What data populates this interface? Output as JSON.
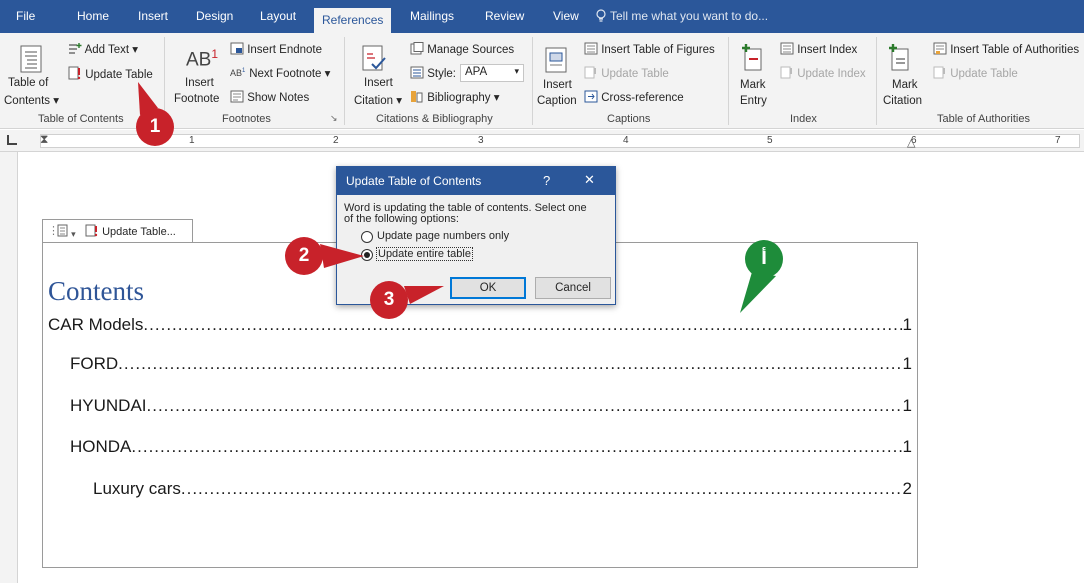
{
  "tabs": [
    "File",
    "Home",
    "Insert",
    "Design",
    "Layout",
    "References",
    "Mailings",
    "Review",
    "View"
  ],
  "tell_me": "Tell me what you want to do...",
  "ribbon": {
    "toc": {
      "add_text": "Add Text",
      "update_table": "Update Table",
      "toc_label_1": "Table of",
      "toc_label_2": "Contents",
      "group": "Table of Contents"
    },
    "footnotes": {
      "ab": "AB",
      "insert_endnote": "Insert Endnote",
      "next_footnote": "Next Footnote",
      "show_notes": "Show Notes",
      "insert_1": "Insert",
      "insert_2": "Footnote",
      "group": "Footnotes"
    },
    "citations": {
      "manage_sources": "Manage Sources",
      "style_label": "Style:",
      "style_value": "APA",
      "bibliography": "Bibliography",
      "insert_1": "Insert",
      "insert_2": "Citation",
      "group": "Citations & Bibliography"
    },
    "captions": {
      "insert_tof": "Insert Table of Figures",
      "update_table": "Update Table",
      "cross_ref": "Cross-reference",
      "insert_1": "Insert",
      "insert_2": "Caption",
      "group": "Captions"
    },
    "index": {
      "insert_index": "Insert Index",
      "update_index": "Update Index",
      "mark_1": "Mark",
      "mark_2": "Entry",
      "group": "Index"
    },
    "toa": {
      "insert_toa": "Insert Table of Authorities",
      "update_table": "Update Table",
      "mark_1": "Mark",
      "mark_2": "Citation",
      "group": "Table of Authorities"
    }
  },
  "ruler_numbers": [
    "1",
    "2",
    "3",
    "4",
    "5",
    "6",
    "7"
  ],
  "toc_control": {
    "update_label": "Update Table..."
  },
  "document": {
    "title": "Contents",
    "entries": [
      {
        "text": "CAR Models ",
        "page": "1"
      },
      {
        "text": "FORD",
        "page": "1"
      },
      {
        "text": "HYUNDAI",
        "page": "1"
      },
      {
        "text": "HONDA ",
        "page": "1"
      },
      {
        "text": "Luxury cars",
        "page": "2"
      }
    ]
  },
  "dialog": {
    "title": "Update Table of Contents",
    "help": "?",
    "close": "✕",
    "message_1": "Word is updating the table of contents.  Select one",
    "message_2": "of the following options:",
    "option_page_numbers": "Update page numbers only",
    "option_entire_table": "Update entire table",
    "ok": "OK",
    "cancel": "Cancel"
  },
  "callouts": {
    "c1": "1",
    "c2": "2",
    "c3": "3",
    "c4": "أ"
  },
  "colors": {
    "brand_blue": "#2b579a",
    "callout_red": "#c8222a",
    "callout_green": "#1e8c3a",
    "title_blue": "#2f5597"
  }
}
